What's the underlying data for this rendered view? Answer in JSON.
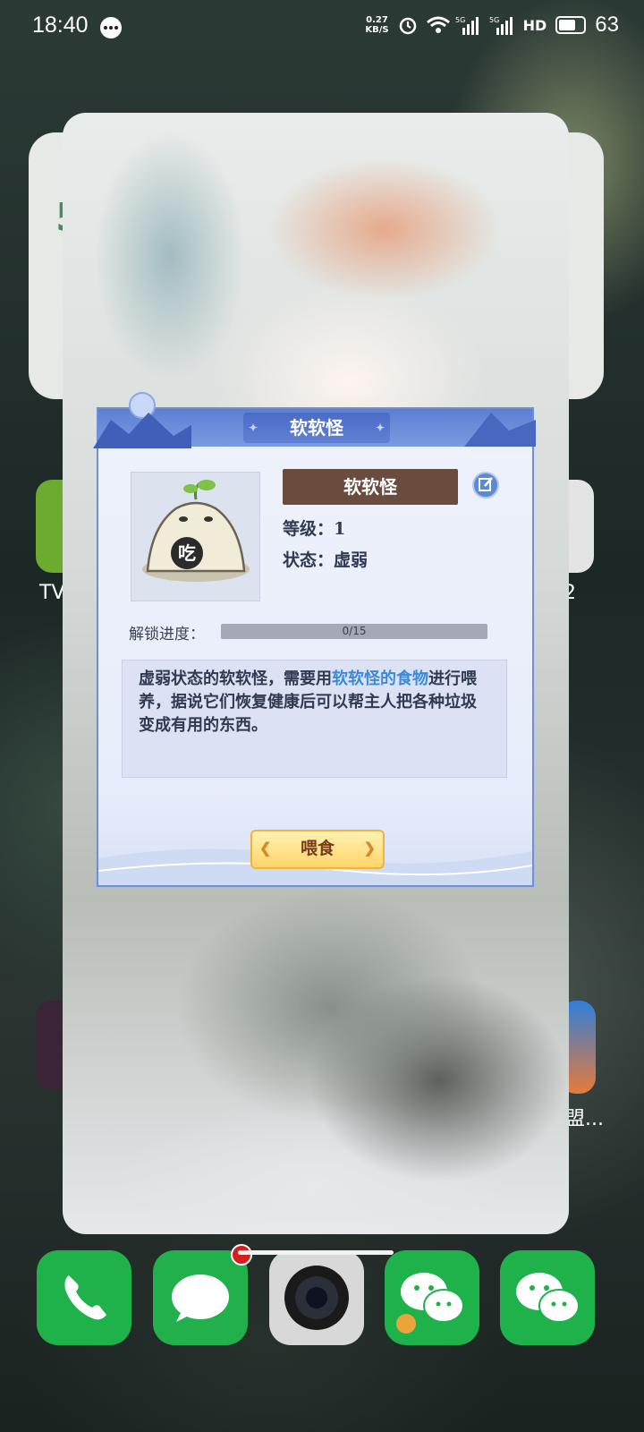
{
  "status_bar": {
    "time": "18:40",
    "net_speed_value": "0.27",
    "net_speed_unit": "KB/S",
    "network_1": "5G",
    "network_2": "5G",
    "hd_label": "HD",
    "battery_level": "63"
  },
  "background": {
    "card_partial_text_1": "5",
    "left_app_label": "TV",
    "right_app_label": "2",
    "right_app2_label": "盟..."
  },
  "dialog": {
    "title": "软软怪",
    "pet_name": "软软怪",
    "pet_icon_text": "吃",
    "level_label": "等级：",
    "level_value": "1",
    "status_label": "状态：",
    "status_value": "虚弱",
    "unlock_label": "解锁进度：",
    "progress_text": "0/15",
    "progress_fraction": 0,
    "description_part1": "虚弱状态的软软怪，需要用",
    "description_highlight": "软软怪的食物",
    "description_part2": "进行喂养，据说它们恢复健康后可以帮主人把各种垃圾变成有用的东西。",
    "feed_button": "喂食"
  },
  "dock": {
    "apps": [
      "phone",
      "messages",
      "camera",
      "wechat",
      "wechat"
    ]
  },
  "colors": {
    "dialog_header": "#5c7fd4",
    "name_plate": "#6a4c3e",
    "highlight_text": "#3a8ad8",
    "feed_button": "#ffd56a",
    "dock_green": "#1fb24a"
  }
}
